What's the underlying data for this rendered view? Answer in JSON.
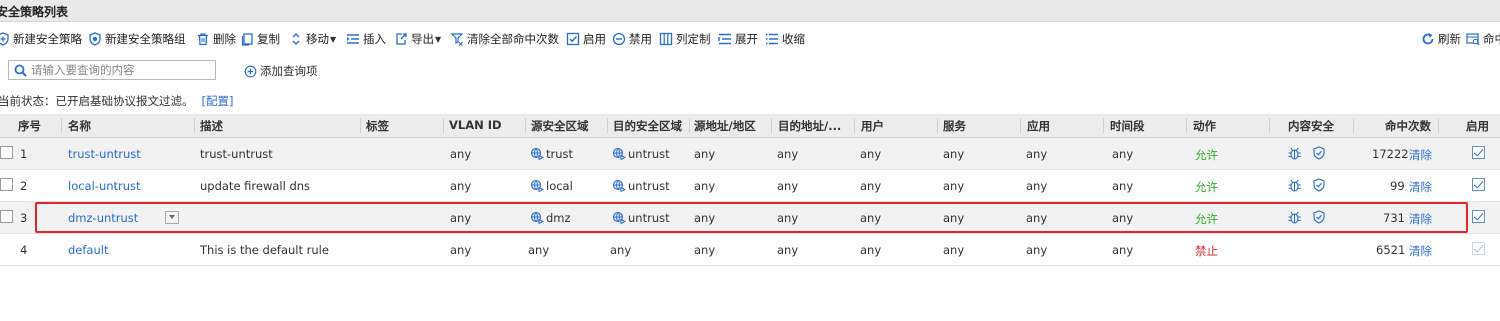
{
  "page_title": "安全策略列表",
  "toolbar": {
    "new_policy": "新建安全策略",
    "new_policy_group": "新建安全策略组",
    "delete": "删除",
    "copy": "复制",
    "move": "移动",
    "insert": "插入",
    "export": "导出",
    "clear_hits": "清除全部命中次数",
    "enable": "启用",
    "disable": "禁用",
    "customize_columns": "列定制",
    "expand": "展开",
    "collapse": "收缩",
    "refresh": "刷新",
    "hit_query": "命中"
  },
  "search": {
    "placeholder": "请输入要查询的内容",
    "add_query": "添加查询项"
  },
  "status": {
    "text": "当前状态：已开启基础协议报文过滤。",
    "link": "[配置]"
  },
  "columns": [
    "序号",
    "名称",
    "描述",
    "标签",
    "VLAN ID",
    "源安全区域",
    "目的安全区域",
    "源地址/地区",
    "目的地址/...",
    "用户",
    "服务",
    "应用",
    "时间段",
    "动作",
    "内容安全",
    "命中次数",
    "启用"
  ],
  "rows": [
    {
      "no": "1",
      "name": "trust-untrust",
      "desc": "trust-untrust",
      "tag": "",
      "vlan": "any",
      "src_zone": "trust",
      "dst_zone": "untrust",
      "src_addr": "any",
      "dst_addr": "any",
      "user": "any",
      "service": "any",
      "app": "any",
      "time": "any",
      "action": "允许",
      "hits": "17222",
      "clear": "清除",
      "enabled": true
    },
    {
      "no": "2",
      "name": "local-untrust",
      "desc": "update firewall dns",
      "tag": "",
      "vlan": "any",
      "src_zone": "local",
      "dst_zone": "untrust",
      "src_addr": "any",
      "dst_addr": "any",
      "user": "any",
      "service": "any",
      "app": "any",
      "time": "any",
      "action": "允许",
      "hits": "99",
      "clear": "清除",
      "enabled": true
    },
    {
      "no": "3",
      "name": "dmz-untrust",
      "desc": "",
      "tag": "",
      "vlan": "any",
      "src_zone": "dmz",
      "dst_zone": "untrust",
      "src_addr": "any",
      "dst_addr": "any",
      "user": "any",
      "service": "any",
      "app": "any",
      "time": "any",
      "action": "允许",
      "hits": "731",
      "clear": "清除",
      "enabled": true
    },
    {
      "no": "4",
      "name": "default",
      "desc": "This is the default rule",
      "tag": "",
      "vlan": "any",
      "src_zone": "any",
      "dst_zone": "any",
      "src_addr": "any",
      "dst_addr": "any",
      "user": "any",
      "service": "any",
      "app": "any",
      "time": "any",
      "action": "禁止",
      "hits": "6521",
      "clear": "清除",
      "enabled": true
    }
  ],
  "colors": {
    "link": "#2a6bd1",
    "allow": "#2eab2e",
    "deny": "#d43030",
    "highlight_border": "#e0282c",
    "header_bg": "#ececec"
  }
}
